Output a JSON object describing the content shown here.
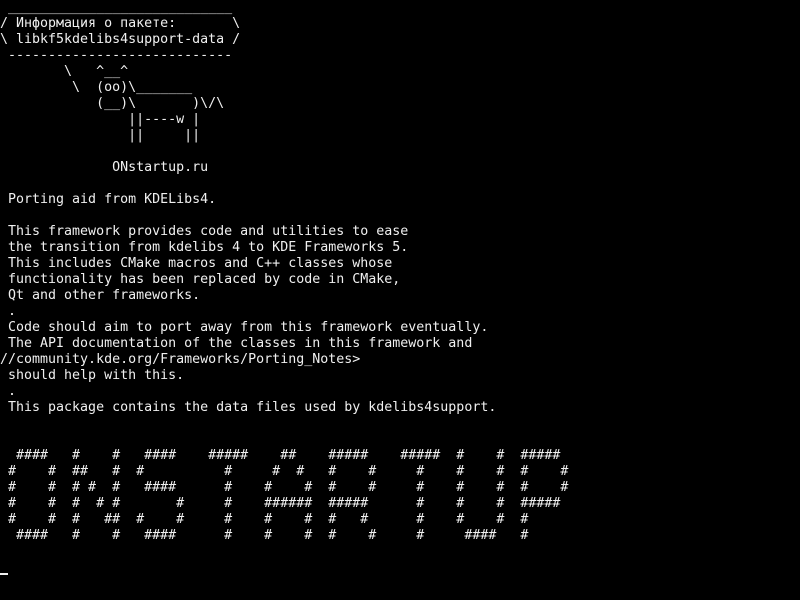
{
  "terminal": {
    "cowsay_bubble": " ____________________________\n/ Информация о пакете:       \\\n\\ libkf5kdelibs4support-data /\n ----------------------------",
    "cow_art": "        \\   ^__^\n         \\  (oo)\\_______\n            (__)\\       )\\/\\\n                ||----w |\n                ||     ||",
    "site_label": "              ONstartup.ru",
    "description": " Porting aid from KDELibs4.\n\n This framework provides code and utilities to ease\n the transition from kdelibs 4 to KDE Frameworks 5.\n This includes CMake macros and C++ classes whose\n functionality has been replaced by code in CMake,\n Qt and other frameworks.\n .\n Code should aim to port away from this framework eventually.\n The API documentation of the classes in this framework and\n//community.kde.org/Frameworks/Porting_Notes>\n should help with this.\n .\n This package contains the data files used by kdelibs4support.",
    "banner_art": "  ####   #    #   ####    #####    ##    #####    #####  #    #  #####\n #    #  ##   #  #          #     #  #   #    #     #    #    #  #    #\n #    #  # #  #   ####      #    #    #  #    #     #    #    #  #    #\n #    #  #  # #       #     #    ######  #####      #    #    #  #####\n #    #  #   ##  #    #     #    #    #  #   #      #    #    #  #\n  ####   #    #   ####      #    #    #  #    #     #     ####   #",
    "fg_color": "#f0f0f0",
    "bg_color": "#000000"
  }
}
